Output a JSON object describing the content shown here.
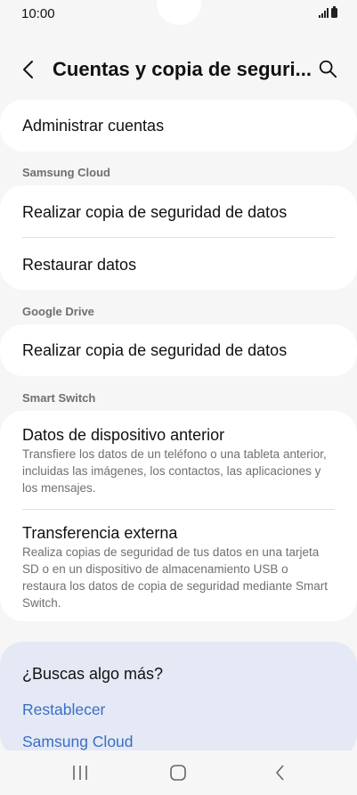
{
  "status_bar": {
    "time": "10:00"
  },
  "header": {
    "back_icon": "chevron-left-icon",
    "title": "Cuentas y copia de seguri...",
    "search_icon": "search-icon"
  },
  "accounts": {
    "manage_label": "Administrar cuentas"
  },
  "samsung_cloud": {
    "section_label": "Samsung Cloud",
    "backup_label": "Realizar copia de seguridad de datos",
    "restore_label": "Restaurar datos"
  },
  "google_drive": {
    "section_label": "Google Drive",
    "backup_label": "Realizar copia de seguridad de datos"
  },
  "smart_switch": {
    "section_label": "Smart Switch",
    "old_device_title": "Datos de dispositivo anterior",
    "old_device_desc": "Transfiere los datos de un teléfono o una tableta anterior, incluidas las imágenes, los contactos, las aplicaciones y los mensajes.",
    "external_title": "Transferencia externa",
    "external_desc": "Realiza copias de seguridad de tus datos en una tarjeta SD o en un dispositivo de almacenamiento USB o restaura los datos de copia de seguridad mediante Smart Switch."
  },
  "suggestions": {
    "title": "¿Buscas algo más?",
    "links": [
      "Restablecer",
      "Samsung Cloud"
    ]
  },
  "colors": {
    "background": "#f6f6f6",
    "card": "#ffffff",
    "suggest_card": "#e4e9f5",
    "link": "#3a6fc4"
  }
}
